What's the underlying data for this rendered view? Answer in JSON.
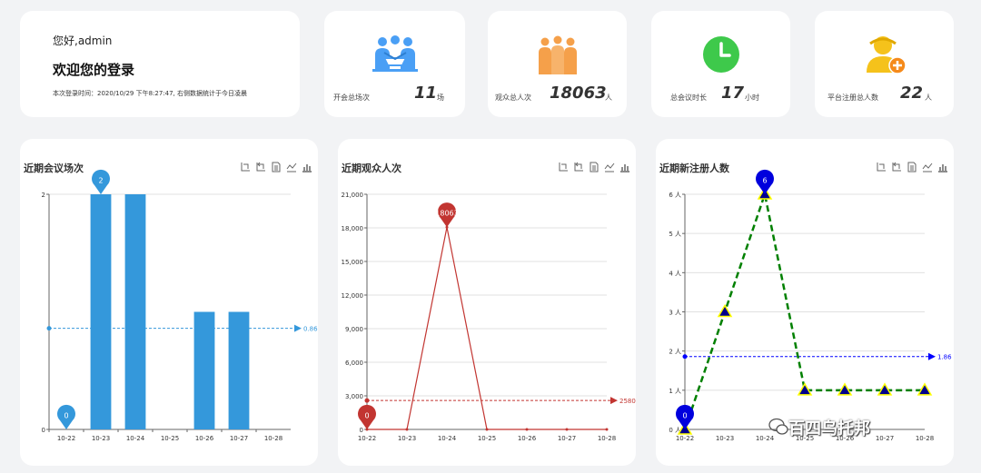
{
  "welcome": {
    "greeting": "您好,admin",
    "title": "欢迎您的登录",
    "login_time": "本次登录时间：2020/10/29 下午8:27:47, 右侧数据统计于今日凌晨"
  },
  "stats": [
    {
      "label": "开会总场次",
      "value": "11",
      "unit": "场",
      "icon": "meeting-icon",
      "color": "#4a9ff5"
    },
    {
      "label": "观众总人次",
      "value": "18063",
      "unit": "人",
      "icon": "audience-icon",
      "color": "#f5a04a"
    },
    {
      "label": "总会议时长",
      "value": "17",
      "unit": "小时",
      "icon": "clock-icon",
      "color": "#3ec94b"
    },
    {
      "label": "平台注册总人数",
      "value": "22",
      "unit": "人",
      "icon": "user-add-icon",
      "color": "#f5c21b"
    }
  ],
  "charts": {
    "meetings": {
      "title": "近期会议场次"
    },
    "audience": {
      "title": "近期观众人次"
    },
    "registrations": {
      "title": "近期新注册人数"
    }
  },
  "chart_data": [
    {
      "type": "bar",
      "title": "近期会议场次",
      "categories": [
        "10-22",
        "10-23",
        "10-24",
        "10-25",
        "10-26",
        "10-27",
        "10-28"
      ],
      "values": [
        0,
        2,
        2,
        0,
        1,
        1,
        0
      ],
      "ylim": [
        0,
        2
      ],
      "yticks": [
        "0",
        "2"
      ],
      "mark_point": {
        "max": "2",
        "min": "0"
      },
      "mark_line": {
        "average": "0.86"
      },
      "color": "#3498db",
      "grid": true
    },
    {
      "type": "line",
      "title": "近期观众人次",
      "categories": [
        "10-22",
        "10-23",
        "10-24",
        "10-25",
        "10-26",
        "10-27",
        "10-28"
      ],
      "values": [
        0,
        0,
        18063,
        0,
        0,
        0,
        0
      ],
      "ylim": [
        0,
        21000
      ],
      "yticks": [
        "0",
        "3,000",
        "6,000",
        "9,000",
        "12,000",
        "15,000",
        "18,000",
        "21,000"
      ],
      "mark_point": {
        "max": "18063",
        "min": "0"
      },
      "mark_line": {
        "average": "2580.43"
      },
      "color": "#c23531",
      "grid": true
    },
    {
      "type": "line",
      "title": "近期新注册人数",
      "categories": [
        "10-22",
        "10-23",
        "10-24",
        "10-25",
        "10-26",
        "10-27",
        "10-28"
      ],
      "values": [
        0,
        3,
        6,
        1,
        1,
        1,
        1
      ],
      "ylim": [
        0,
        6
      ],
      "yticks": [
        "0 人",
        "1 人",
        "2 人",
        "3 人",
        "4 人",
        "5 人",
        "6 人"
      ],
      "mark_point": {
        "max": "6",
        "min": "0"
      },
      "mark_line": {
        "average": "1.86"
      },
      "color": "#008000",
      "marker_color": "#00008b",
      "grid": true
    }
  ],
  "watermark": "百四乌托邦"
}
